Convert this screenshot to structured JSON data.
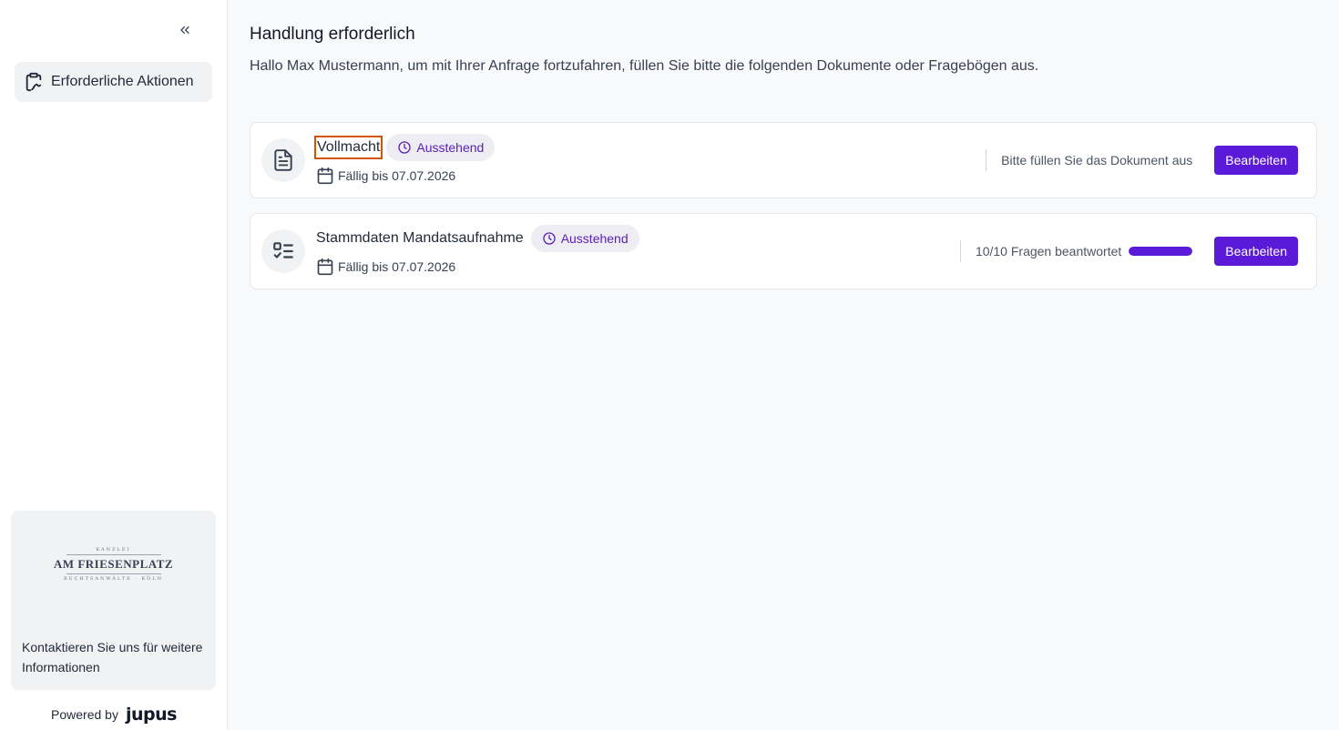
{
  "sidebar": {
    "collapse_icon": "chevrons-left-icon",
    "nav": [
      {
        "label": "Erforderliche Aktionen",
        "icon": "clipboard-signature-icon",
        "active": true
      }
    ],
    "contact": {
      "logo": {
        "top": "KANZLEI",
        "brand": "AM FRIESENPLATZ",
        "bottom": "RECHTSANWÄLTE · KÖLN"
      },
      "text": "Kontaktieren Sie uns für weitere Informationen"
    },
    "powered_by": "Powered by",
    "powered_brand": "jupus"
  },
  "main": {
    "title": "Handlung erforderlich",
    "subtitle": "Hallo Max Mustermann, um mit Ihrer Anfrage fortzufahren, füllen Sie bitte die folgenden Dokumente oder Fragebögen aus.",
    "items": [
      {
        "title": "Vollmacht",
        "icon": "document-text-icon",
        "badge": "Ausstehend",
        "due": "Fällig bis 07.07.2026",
        "status": "Bitte füllen Sie das Dokument aus",
        "button": "Bearbeiten"
      },
      {
        "title": "Stammdaten Mandatsaufnahme",
        "icon": "checklist-icon",
        "badge": "Ausstehend",
        "due": "Fällig bis 07.07.2026",
        "status": "10/10 Fragen beantwortet",
        "progress": 1.0,
        "button": "Bearbeiten"
      }
    ]
  },
  "colors": {
    "accent": "#5b1ad8",
    "badge_bg": "#eeedf3",
    "badge_text": "#5b21b6",
    "focus_outline": "#d35400"
  }
}
